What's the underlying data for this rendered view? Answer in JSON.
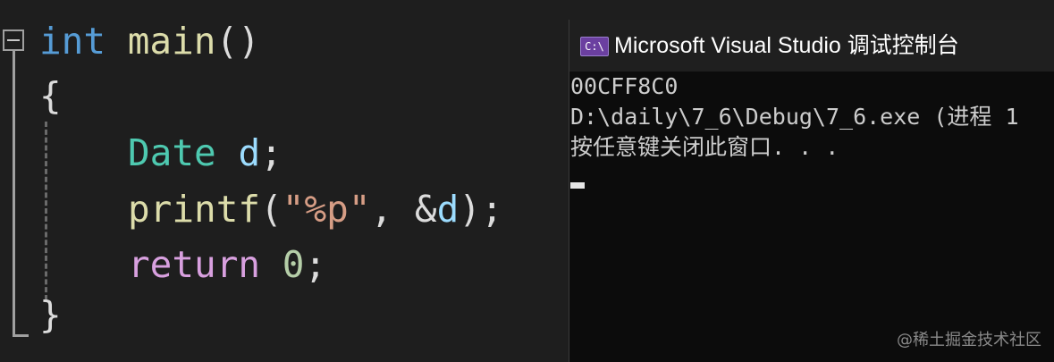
{
  "editor": {
    "line1": {
      "kw": "int",
      "fn": "main",
      "punc": "()"
    },
    "line2": {
      "brace": "{"
    },
    "line3": {
      "type": "Date",
      "var": "d",
      "punc": ";"
    },
    "line4": {
      "fn": "printf",
      "open": "(",
      "str": "\"%p\"",
      "comma": ",",
      "amp": "&",
      "var": "d",
      "close": ");"
    },
    "line5": {
      "kw": "return",
      "num": "0",
      "punc": ";"
    },
    "line6": {
      "brace": "}"
    }
  },
  "console": {
    "icon_label": "C:\\",
    "title": "Microsoft Visual Studio 调试控制台",
    "lines": [
      "00CFF8C0",
      "D:\\daily\\7_6\\Debug\\7_6.exe (进程 1",
      "按任意键关闭此窗口. . ."
    ]
  },
  "watermark": "@稀土掘金技术社区",
  "colors": {
    "keyword": "#569cd6",
    "function": "#dcdcaa",
    "type": "#4ec9b0",
    "variable": "#9cdcfe",
    "string": "#d69d85",
    "control": "#d8a0df",
    "number": "#b5cea8",
    "editor_bg": "#1e1e1e",
    "console_bg": "#0c0c0c"
  },
  "icons": {
    "collapse": "collapse-minus-icon",
    "console_app": "console-app-icon"
  }
}
